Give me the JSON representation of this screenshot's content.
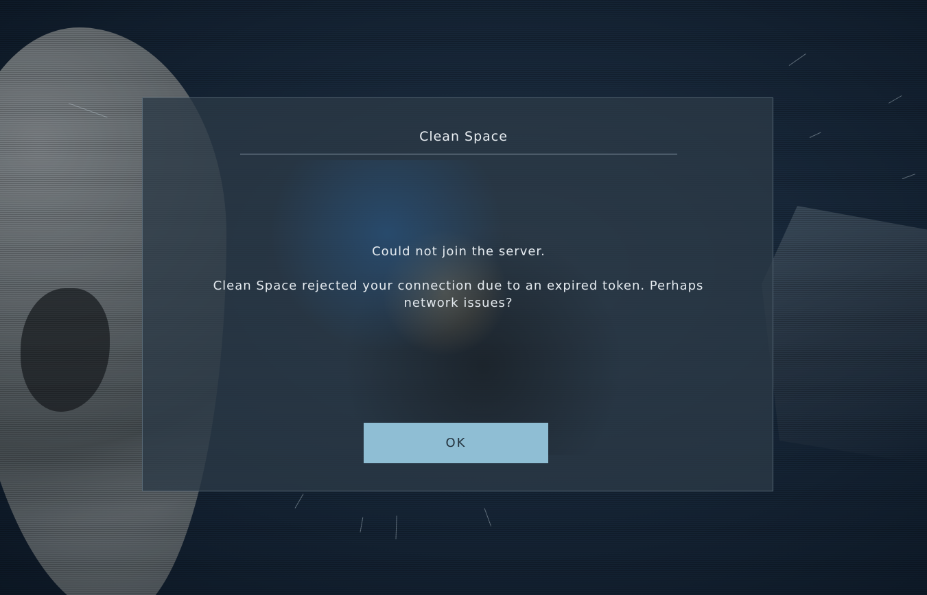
{
  "dialog": {
    "title": "Clean Space",
    "message_primary": "Could not join the server.",
    "message_detail": "Clean Space rejected your connection due to an expired token. Perhaps network issues?",
    "ok_label": "OK"
  },
  "colors": {
    "button_bg": "#8fbed4",
    "button_text": "#24333e",
    "dialog_text": "#e4eaef",
    "dialog_bg": "#2c3a46"
  }
}
